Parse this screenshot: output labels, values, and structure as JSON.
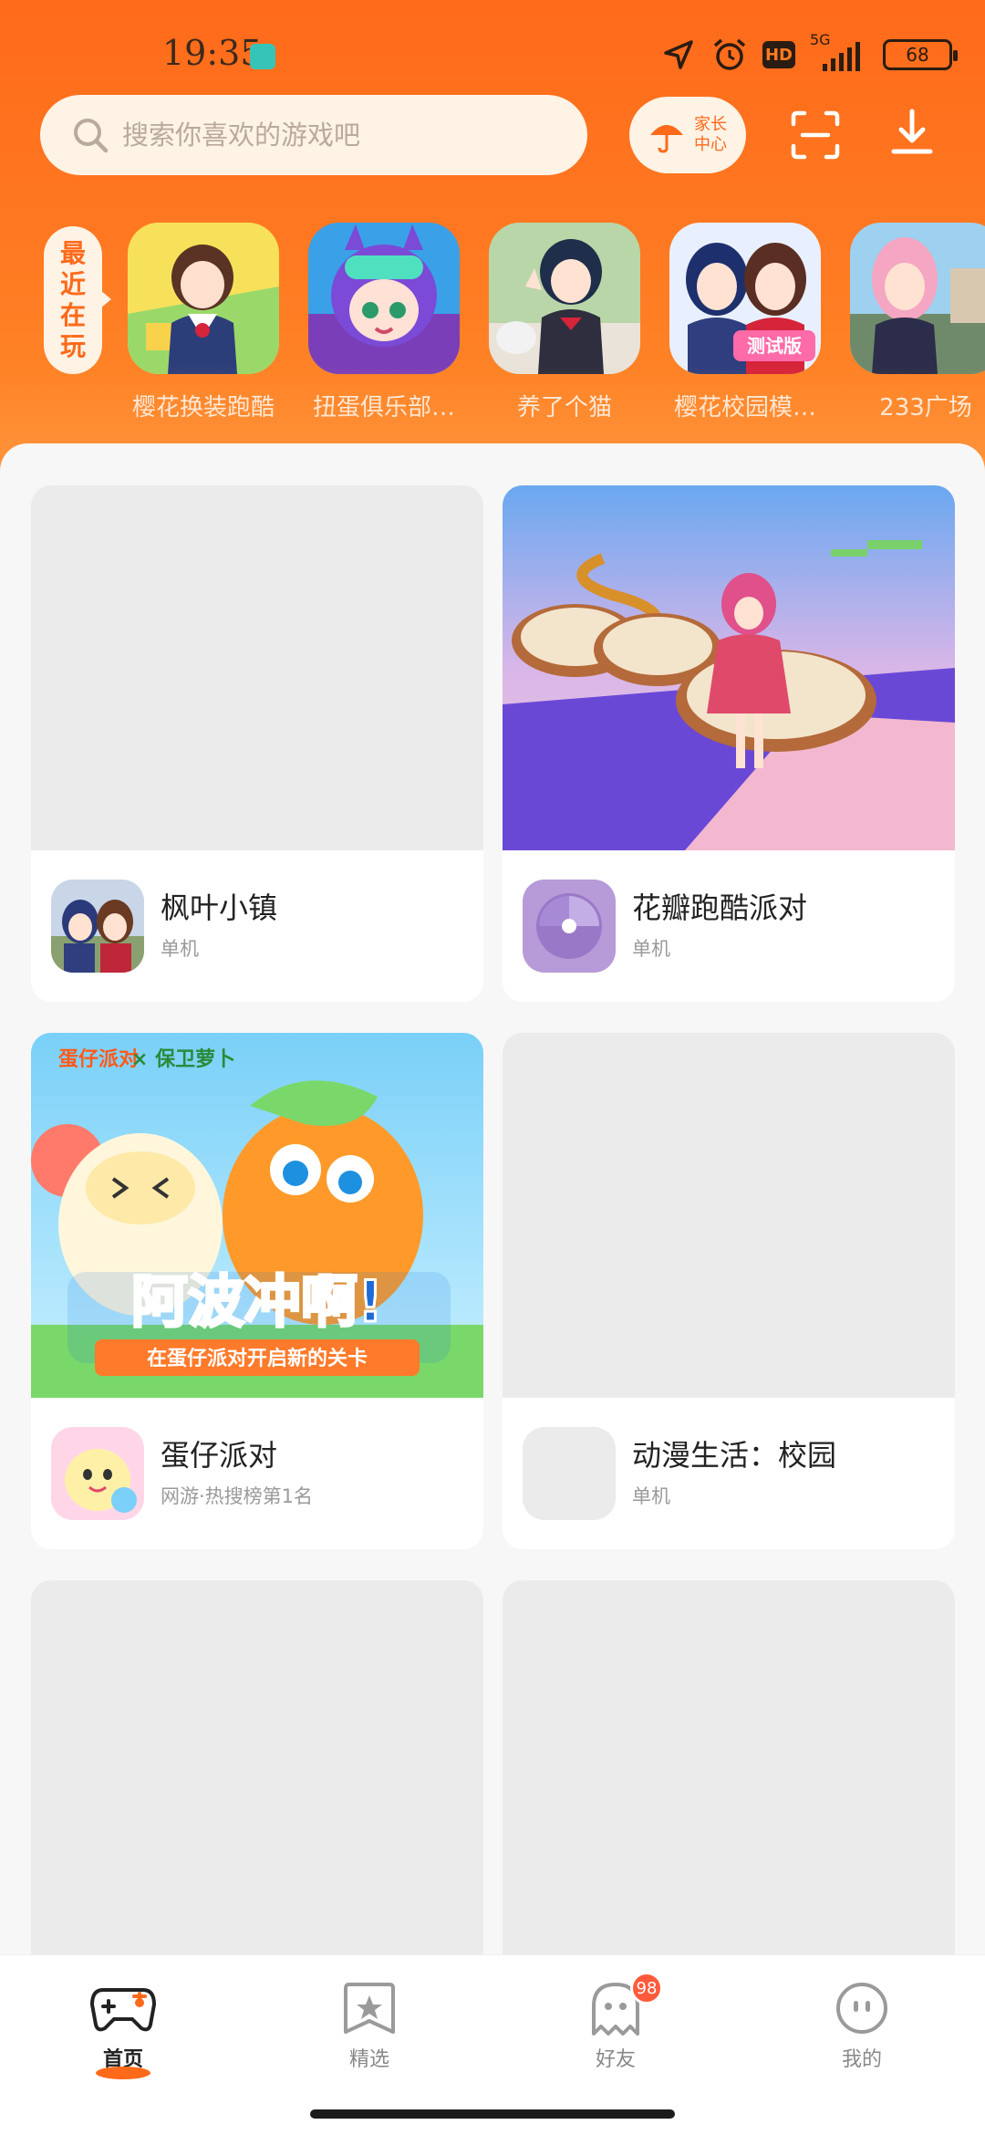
{
  "status_bar": {
    "time": "19:35",
    "network": "5G",
    "battery": "68"
  },
  "search": {
    "placeholder": "搜索你喜欢的游戏吧"
  },
  "parent_center": {
    "label_top": "家长",
    "label_bottom": "中心"
  },
  "recent": {
    "label_chars": [
      "最",
      "近",
      "在",
      "玩"
    ],
    "items": [
      {
        "name": "樱花换装跑酷"
      },
      {
        "name": "扭蛋俱乐部…"
      },
      {
        "name": "养了个猫"
      },
      {
        "name": "樱花校园模…"
      },
      {
        "name": "233广场"
      }
    ]
  },
  "cards": [
    {
      "title": "枫叶小镇",
      "subtitle": "单机"
    },
    {
      "title": "花瓣跑酷派对",
      "subtitle": "单机"
    },
    {
      "title": "蛋仔派对",
      "subtitle": "网游·热搜榜第1名",
      "banner_line1": "阿波冲啊!",
      "banner_line2": "在蛋仔派对开启新的关卡"
    },
    {
      "title": "动漫生活：校园",
      "subtitle": "单机"
    }
  ],
  "bottom_nav": [
    {
      "label": "首页",
      "active": true
    },
    {
      "label": "精选",
      "active": false
    },
    {
      "label": "好友",
      "active": false,
      "badge": "98"
    },
    {
      "label": "我的",
      "active": false
    }
  ],
  "colors": {
    "brand_orange": "#ff6a1a",
    "badge_red": "#ff5a3c"
  }
}
